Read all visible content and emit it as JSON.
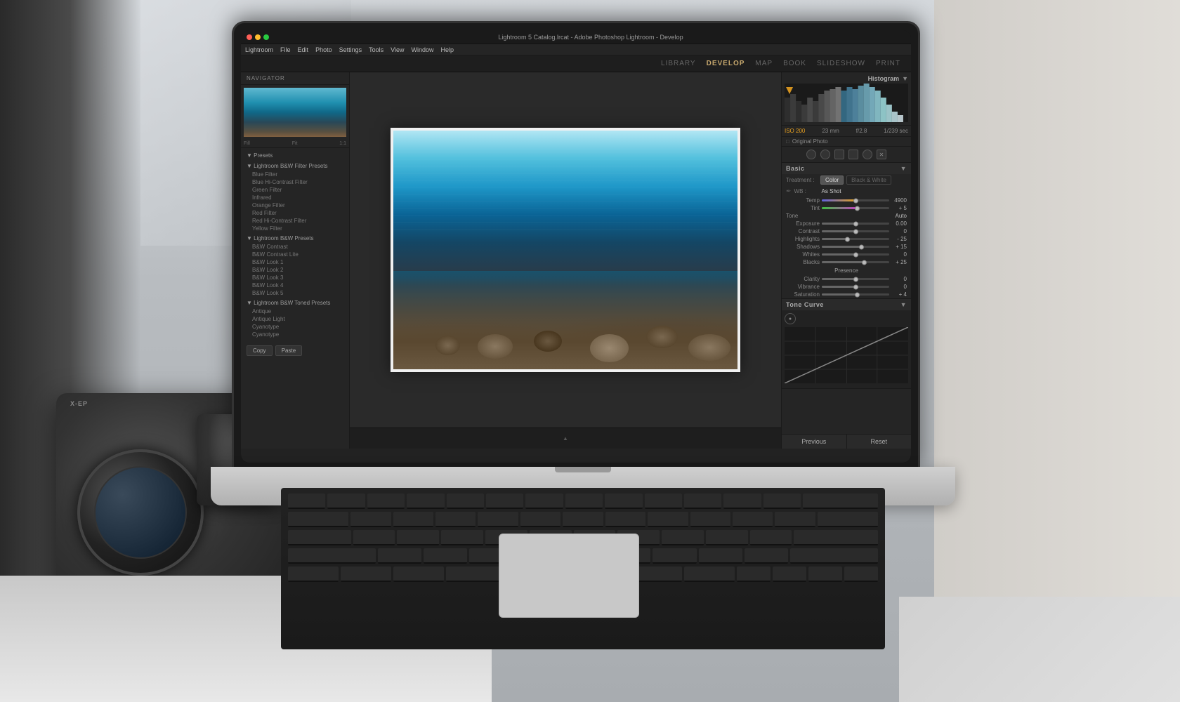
{
  "scene": {
    "background_desc": "Blurry room with window blinds and bokeh"
  },
  "laptop": {
    "title_bar": {
      "title": "Lightroom 5 Catalog.lrcat - Adobe Photoshop Lightroom - Develop",
      "traffic_lights": [
        "red",
        "yellow",
        "green"
      ]
    },
    "menu": {
      "items": [
        "Lightroom",
        "File",
        "Edit",
        "Photo",
        "Settings",
        "Tools",
        "View",
        "Window",
        "Help"
      ]
    },
    "module_picker": {
      "items": [
        "LIBRARY",
        "DEVELOP",
        "MAP",
        "BOOK",
        "SLIDESHOW",
        "PRINT"
      ],
      "active": "DEVELOP"
    },
    "left_panel": {
      "header": "Navigator",
      "nav_controls": "◀ ▶",
      "zoom_levels": [
        "Fill",
        "Fit",
        "1:1"
      ],
      "preset_groups": [
        {
          "label": "▼ Presets",
          "items": []
        },
        {
          "label": "▼ Lightroom B&W Filter Presets",
          "items": [
            "Blue Filter",
            "Blue Hi-Contrast Filter",
            "Green Filter",
            "Infrared",
            "Orange Filter",
            "Red Filter",
            "Red Hi-Contrast Filter",
            "Yellow Filter"
          ]
        },
        {
          "label": "▼ Lightroom B&W Presets",
          "items": [
            "B&W Contrast",
            "B&W Contrast Lite",
            "B&W Look 1",
            "B&W Look 2",
            "B&W Look 3",
            "B&W Look 4",
            "B&W Look 5"
          ]
        },
        {
          "label": "▼ Lightroom B&W Toned Presets",
          "items": [
            "Antique",
            "Antique Light",
            "Cyanotype",
            "Cyanotype"
          ]
        }
      ],
      "copy_label": "Copy",
      "paste_label": "Paste"
    },
    "right_panel": {
      "histogram_label": "Histogram",
      "camera_info": {
        "iso": "ISO 200",
        "focal_length": "23 mm",
        "aperture": "f/2.8",
        "shutter": "1/239 sec"
      },
      "original_photo": "Original Photo",
      "basic_section": {
        "label": "Basic",
        "treatment_label": "Treatment :",
        "color_btn": "Color",
        "bw_btn": "Black & White",
        "wb_label": "WB :",
        "wb_value": "As Shot",
        "tone_label": "Tone",
        "auto_btn": "Auto",
        "sliders": [
          {
            "label": "Temp",
            "value": "4900",
            "pos": 0.5,
            "color": "#e8b060"
          },
          {
            "label": "Tint",
            "value": "+ 5",
            "pos": 0.52,
            "color": "#c060c0"
          },
          {
            "label": "Exposure",
            "value": "0.00",
            "pos": 0.5,
            "color": "#888"
          },
          {
            "label": "Contrast",
            "value": "0",
            "pos": 0.5,
            "color": "#888"
          },
          {
            "label": "Highlights",
            "value": "- 25",
            "pos": 0.38,
            "color": "#888"
          },
          {
            "label": "Shadows",
            "value": "+ 15",
            "pos": 0.58,
            "color": "#888"
          },
          {
            "label": "Whites",
            "value": "0",
            "pos": 0.5,
            "color": "#888"
          },
          {
            "label": "Blacks",
            "value": "+ 25",
            "pos": 0.62,
            "color": "#888"
          }
        ],
        "presence_label": "Presence",
        "presence_sliders": [
          {
            "label": "Clarity",
            "value": "0",
            "pos": 0.5,
            "color": "#888"
          },
          {
            "label": "Vibrance",
            "value": "0",
            "pos": 0.5,
            "color": "#888"
          },
          {
            "label": "Saturation",
            "value": "+ 4",
            "pos": 0.52,
            "color": "#888"
          }
        ]
      },
      "tone_curve_section": {
        "label": "Tone Curve"
      },
      "previous_btn": "Previous",
      "reset_btn": "Reset"
    }
  }
}
